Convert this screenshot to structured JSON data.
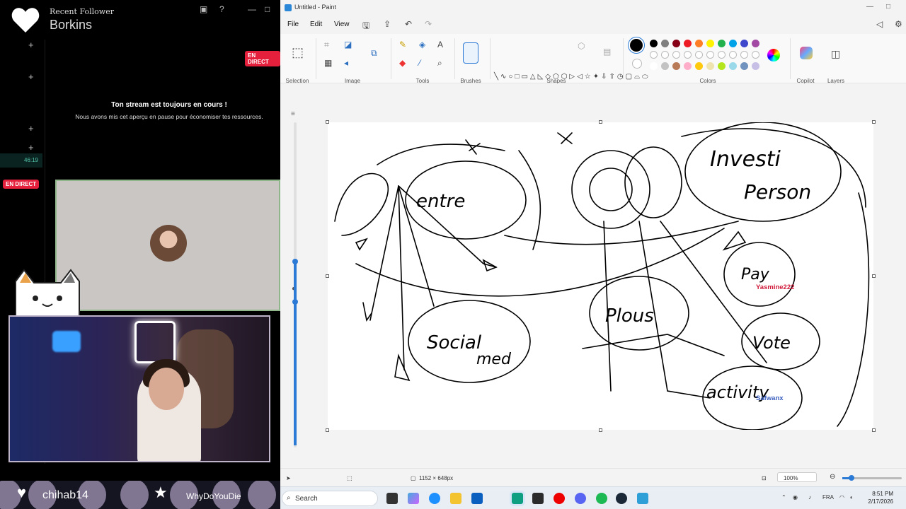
{
  "stream": {
    "label_small": "Recent Follower",
    "streamer_name": "Borkins",
    "live_badge": "EN DIRECT",
    "notice_title": "Ton stream est toujours en cours !",
    "notice_sub": "Nous avons mis cet aperçu en pause pour économiser tes ressources.",
    "timer": "46:19",
    "icons": [
      "heart-icon",
      "plus-icon",
      "gift-icon",
      "help-icon",
      "cat-icon"
    ]
  },
  "streambar": {
    "follower": "chihab14",
    "subscriber": "WhyDoYouDie"
  },
  "paint": {
    "window_title": "Untitled - Paint",
    "menu": [
      "File",
      "Edit",
      "View"
    ],
    "groups": {
      "selection": "Selection",
      "image": "Image",
      "tools": "Tools",
      "brushes": "Brushes",
      "shapes": "Shapes",
      "colors": "Colors",
      "copilot": "Copilot",
      "layers": "Layers"
    },
    "current_color": "#000000",
    "palette_row1": [
      "#000000",
      "#7f7f7f",
      "#880015",
      "#ed1c24",
      "#ff7f27",
      "#fff200",
      "#22b14c",
      "#00a2e8",
      "#3f48cc",
      "#a349a4"
    ],
    "palette_row2": [
      "#ffffff",
      "#c3c3c3",
      "#b97a57",
      "#ffaec9",
      "#ffc90e",
      "#efe4b0",
      "#b5e61d",
      "#99d9ea",
      "#7092be",
      "#c8bfe7"
    ],
    "status": {
      "canvas_size": "1152 × 648px",
      "zoom": "100%"
    }
  },
  "drawing_words": [
    "Investi",
    "Person",
    "entre",
    "Social",
    "med",
    "Plous",
    "Pay",
    "Vote",
    "activity"
  ],
  "chat": [
    {
      "user": "Yasmine222",
      "color": "#d11a3a"
    },
    {
      "user": "Safwanx",
      "color": "#3b5fc0"
    }
  ],
  "taskbar": {
    "search_placeholder": "Search",
    "language": "FRA",
    "time": "8:51 PM",
    "date": "2/17/2026"
  }
}
